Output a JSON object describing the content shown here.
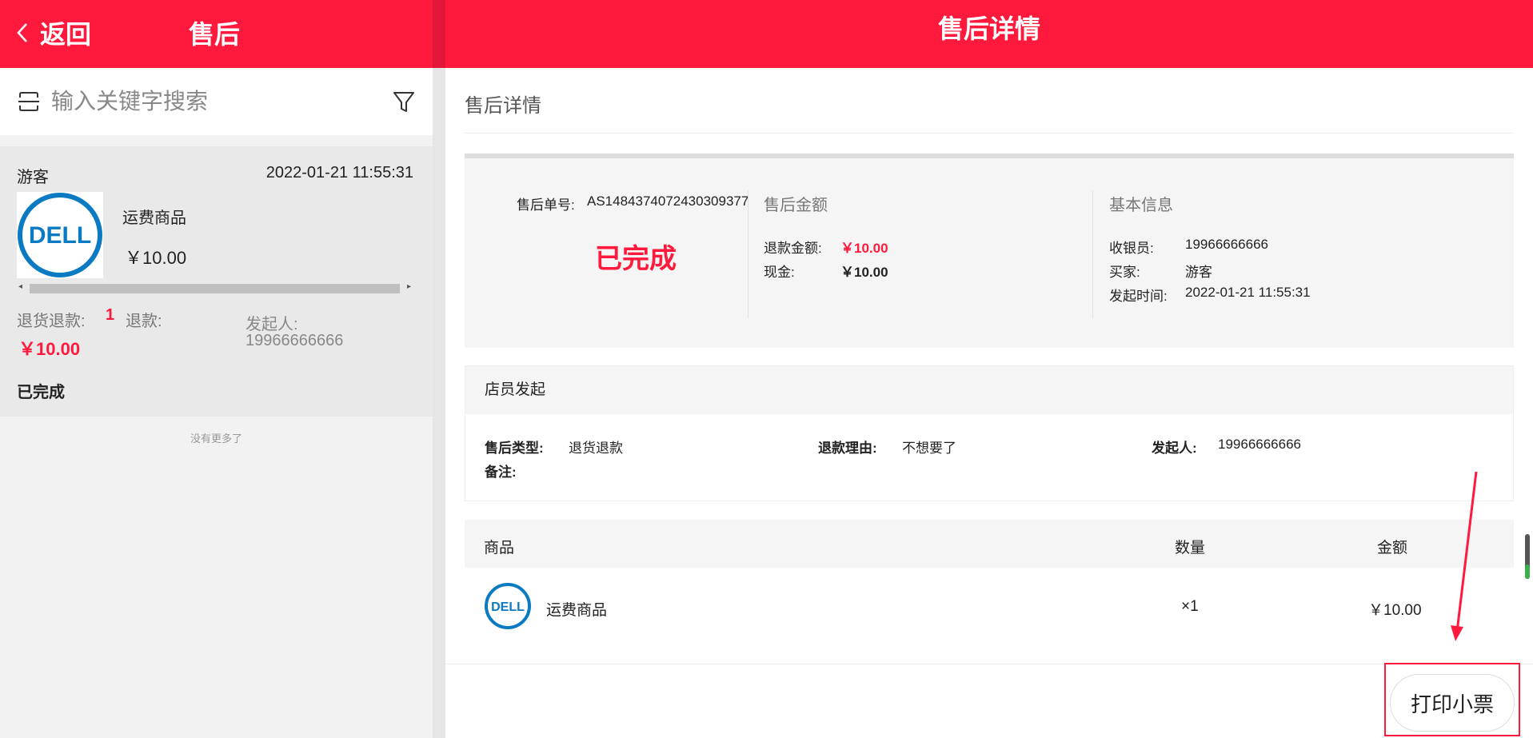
{
  "left": {
    "back_label": "返回",
    "title": "售后",
    "search_placeholder": "输入关键字搜索",
    "card": {
      "buyer": "游客",
      "time": "2022-01-21 11:55:31",
      "product_name": "运费商品",
      "product_price": "￥10.00",
      "return_label": "退货退款:",
      "quantity": "1",
      "refund_label": "退款:",
      "refund_amount": "￥10.00",
      "initiator_label": "发起人:",
      "initiator": "19966666666",
      "status": "已完成"
    },
    "no_more": "没有更多了"
  },
  "right": {
    "title": "售后详情",
    "subtitle": "售后详情",
    "summary": {
      "order_no_label": "售后单号:",
      "order_no": "AS1484374072430309377",
      "status": "已完成",
      "amount_heading": "售后金额",
      "refund_amount_label": "退款金额:",
      "refund_amount": "￥10.00",
      "cash_label": "现金:",
      "cash": "￥10.00",
      "basic_heading": "基本信息",
      "cashier_label": "收银员:",
      "cashier": "19966666666",
      "buyer_label": "买家:",
      "buyer": "游客",
      "time_label": "发起时间:",
      "time": "2022-01-21 11:55:31"
    },
    "initiate": {
      "heading": "店员发起",
      "type_label": "售后类型:",
      "type": "退货退款",
      "reason_label": "退款理由:",
      "reason": "不想要了",
      "initiator_label": "发起人:",
      "initiator": "19966666666",
      "remark_label": "备注:",
      "remark": ""
    },
    "goods": {
      "col_product": "商品",
      "col_qty": "数量",
      "col_amount": "金额",
      "rows": [
        {
          "name": "运费商品",
          "qty": "×1",
          "amount": "￥10.00",
          "logo": "DELL"
        }
      ]
    },
    "print_button": "打印小票"
  },
  "colors": {
    "brand": "#ff1a3d",
    "panel": "#f5f5f5"
  },
  "icons": [
    "back-chevron-icon",
    "scan-icon",
    "filter-icon",
    "dell-logo"
  ]
}
